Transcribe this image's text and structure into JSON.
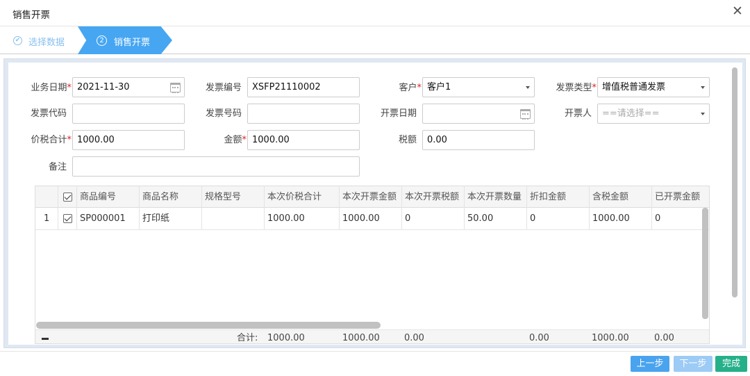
{
  "window": {
    "title": "销售开票",
    "close_glyph": "✕"
  },
  "steps": [
    {
      "label": "选择数据",
      "state": "done",
      "icon": "check-circle-icon",
      "glyph": "✔"
    },
    {
      "label": "销售开票",
      "state": "active",
      "number": "2"
    }
  ],
  "form": {
    "biz_date": {
      "label": "业务日期",
      "value": "2021-11-30"
    },
    "invoice_no": {
      "label": "发票编号",
      "value": "XSFP21110002"
    },
    "customer": {
      "label": "客户",
      "value": "客户1"
    },
    "invoice_type": {
      "label": "发票类型",
      "value": "增值税普通发票"
    },
    "invoice_code": {
      "label": "发票代码",
      "value": ""
    },
    "invoice_number": {
      "label": "发票号码",
      "value": ""
    },
    "issue_date": {
      "label": "开票日期",
      "value": ""
    },
    "issuer": {
      "label": "开票人",
      "placeholder": "==请选择=="
    },
    "total_with_tax": {
      "label": "价税合计",
      "value": "1000.00"
    },
    "amount": {
      "label": "金额",
      "value": "1000.00"
    },
    "tax": {
      "label": "税额",
      "value": "0.00"
    },
    "remark": {
      "label": "备注",
      "value": ""
    },
    "required_mark": "*"
  },
  "grid": {
    "columns": [
      "商品编号",
      "商品名称",
      "规格型号",
      "本次价税合计",
      "本次开票金额",
      "本次开票税额",
      "本次开票数量",
      "折扣金额",
      "含税金额",
      "已开票金额"
    ],
    "rows": [
      {
        "index": "1",
        "checked": true,
        "cells": [
          "SP000001",
          "打印纸",
          "",
          "1000.00",
          "1000.00",
          "0",
          "50.00",
          "0",
          "1000.00",
          "0"
        ]
      }
    ],
    "footer": {
      "label": "合计:",
      "total_with_tax": "1000.00",
      "amount": "1000.00",
      "tax": "0.00",
      "discount": "0.00",
      "taxed_amount": "1000.00",
      "invoiced": "0.00"
    }
  },
  "buttons": {
    "prev": {
      "label": "上一步",
      "color": "#4aa3ee"
    },
    "next": {
      "label": "下一步",
      "color": "#9ccbf5"
    },
    "finish": {
      "label": "完成",
      "color": "#26b08a"
    }
  }
}
